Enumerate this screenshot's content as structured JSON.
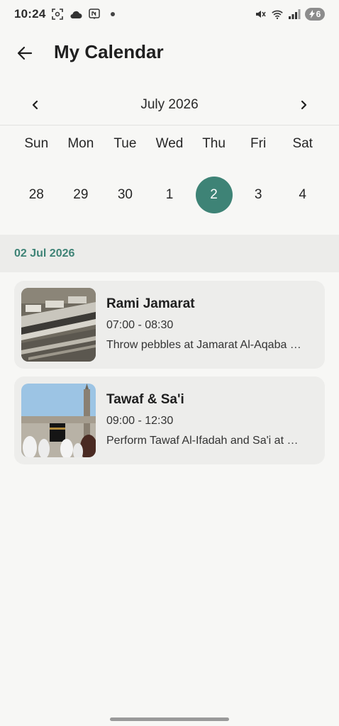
{
  "status_bar": {
    "time": "10:24",
    "battery_level": "6",
    "left_icons": [
      "screenshot-icon",
      "cloud-icon",
      "n-notification-icon",
      "dot-icon"
    ],
    "right_icons": [
      "mute-icon",
      "wifi-icon",
      "signal-icon",
      "battery-icon"
    ]
  },
  "app_bar": {
    "title": "My Calendar",
    "back_icon": "arrow-left-icon"
  },
  "calendar": {
    "month_label": "July 2026",
    "weekdays": [
      "Sun",
      "Mon",
      "Tue",
      "Wed",
      "Thu",
      "Fri",
      "Sat"
    ],
    "dates": [
      "28",
      "29",
      "30",
      "1",
      "2",
      "3",
      "4"
    ],
    "selected_date": "2",
    "accent_color": "#3e8376"
  },
  "agenda": {
    "section_date": "02 Jul 2026",
    "events": [
      {
        "title": "Rami Jamarat",
        "time": "07:00 - 08:30",
        "description": "Throw pebbles at Jamarat Al-Aqaba …"
      },
      {
        "title": "Tawaf & Sa'i",
        "time": "09:00 - 12:30",
        "description": "Perform Tawaf Al-Ifadah and Sa'i at …"
      }
    ]
  }
}
